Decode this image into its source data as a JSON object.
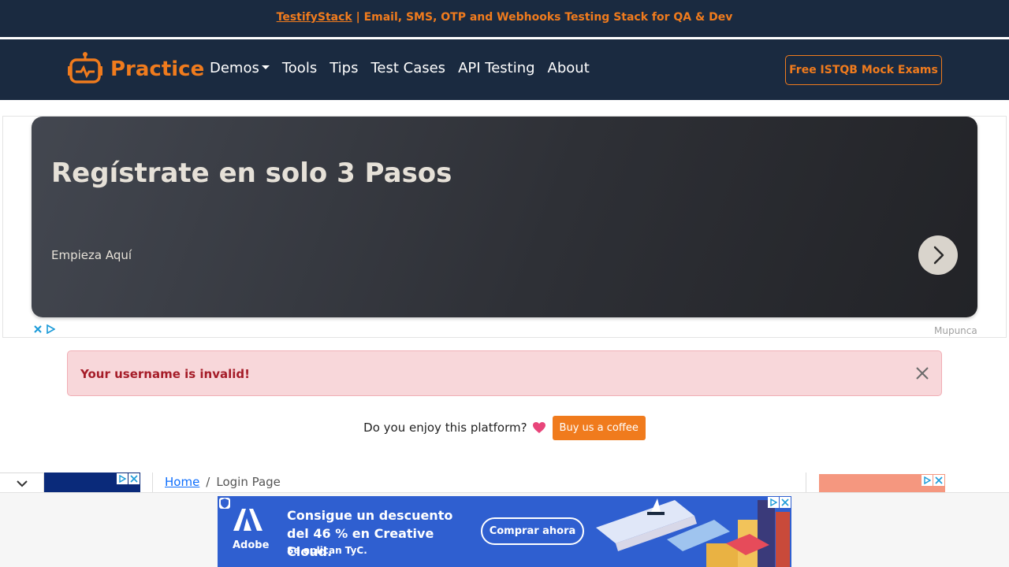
{
  "banner": {
    "link_text": "TestifyStack",
    "text": " | Email, SMS, OTP and Webhooks Testing Stack for QA & Dev"
  },
  "nav": {
    "brand": "Practice",
    "links": [
      "Demos",
      "Tools",
      "Tips",
      "Test Cases",
      "API Testing",
      "About"
    ],
    "cta": "Free ISTQB Mock Exams"
  },
  "ad": {
    "title": "Regístrate en solo 3 Pasos",
    "subtitle": "Empieza Aquí",
    "credit": "Mupunca"
  },
  "alert": {
    "message": "Your username is invalid!"
  },
  "coffee": {
    "text": "Do you enjoy this platform?",
    "button": "Buy us a coffee"
  },
  "breadcrumb": {
    "home": "Home",
    "separator": "/",
    "current": "Login Page"
  },
  "bottom_ad": {
    "brand": "Adobe",
    "headline": "Consigue un descuento del 46 % en Creative Cloud.",
    "note": "Se aplican TyC.",
    "button": "Comprar ahora"
  },
  "colors": {
    "navy": "#1a2a40",
    "orange": "#f07b1d",
    "alert_bg": "#f8d7da",
    "alert_text": "#a51c28",
    "ad_blue": "#2f5fd0"
  },
  "icons": [
    "robot-logo-icon",
    "caret-down-icon",
    "chevron-right-icon",
    "close-icon",
    "ad-choices-icon",
    "heart-icon",
    "chevron-down-icon",
    "shield-icon",
    "adobe-logo-icon"
  ]
}
